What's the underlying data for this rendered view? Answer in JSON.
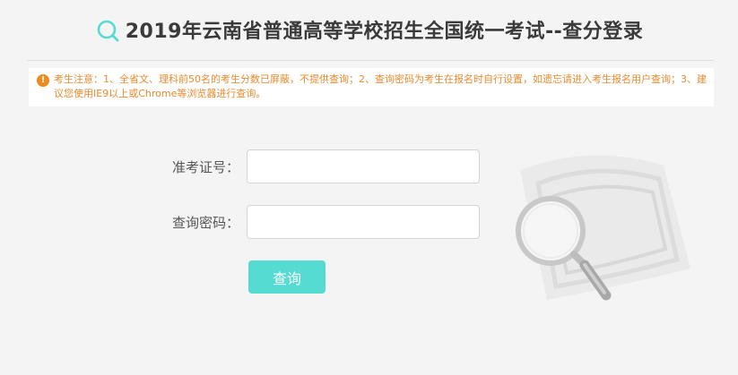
{
  "header": {
    "title": "2019年云南省普通高等学校招生全国统一考试--查分登录",
    "logo_icon": "search-icon"
  },
  "notice": {
    "icon": "warning-icon",
    "text": "考生注意：1、全省文、理科前50名的考生分数已屏蔽，不提供查询；2、查询密码为考生在报名时自行设置，如遗忘请进入考生报名用户查询；3、建议您使用IE9以上或Chrome等浏览器进行查询。"
  },
  "form": {
    "exam_number_label": "准考证号：",
    "exam_number_value": "",
    "password_label": "查询密码：",
    "password_value": "",
    "submit_label": "查询"
  },
  "colors": {
    "accent": "#55dbd1",
    "notice_text": "#e98a2e",
    "warning_icon": "#f08a1c",
    "title": "#3a3a3a"
  }
}
